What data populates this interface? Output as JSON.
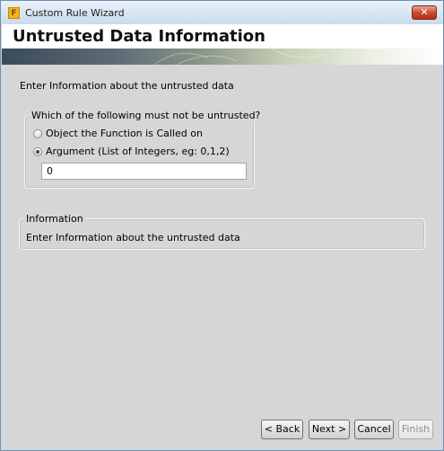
{
  "window": {
    "title": "Custom Rule Wizard",
    "icon_letter": "F",
    "close_symbol": "✕"
  },
  "banner": {
    "title": "Untrusted Data Information"
  },
  "intro": "Enter Information about the untrusted data",
  "untrusted_group": {
    "title": "Which of the following must not be untrusted?",
    "options": [
      {
        "label": "Object the Function is Called on",
        "selected": false
      },
      {
        "label": "Argument (List of Integers, eg: 0,1,2)",
        "selected": true
      }
    ],
    "argument_value": "0"
  },
  "info_group": {
    "title": "Information",
    "text": "Enter Information about the untrusted data"
  },
  "buttons": {
    "back": "< Back",
    "next": "Next >",
    "cancel": "Cancel",
    "finish": "Finish",
    "finish_enabled": false
  }
}
